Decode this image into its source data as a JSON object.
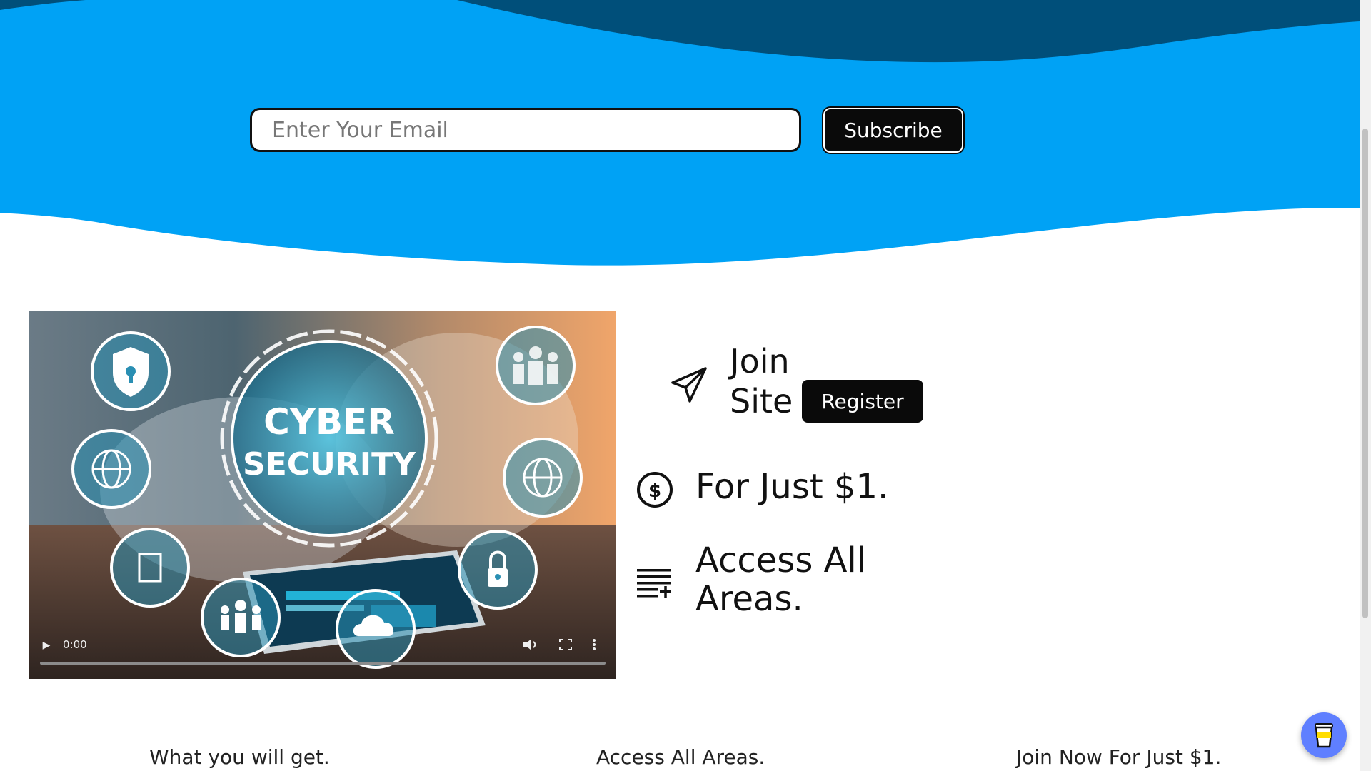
{
  "newsletter": {
    "email_placeholder": "Enter Your Email",
    "email_value": "",
    "subscribe_label": "Subscribe"
  },
  "video": {
    "time": "0:00",
    "progress": 0,
    "poster_text_line1": "CYBER",
    "poster_text_line2": "SECURITY"
  },
  "features": {
    "join_line1": "Join",
    "join_line2": "Site",
    "register_label": "Register",
    "price": "For Just $1.",
    "access_line1": "Access All",
    "access_line2": "Areas."
  },
  "bottom": {
    "col1": "What you will get.",
    "col2": "Access All Areas.",
    "col3": "Join Now For Just $1."
  },
  "icons": {
    "join": "paper-plane-icon",
    "price": "dollar-circle-icon",
    "access": "playlist-add-icon",
    "coffee": "coffee-cup-icon"
  },
  "colors": {
    "hero_light": "#00a2f5",
    "hero_dark": "#004f7a",
    "button_dark": "#0a0a0a",
    "coffee_button": "#5f7fff"
  }
}
